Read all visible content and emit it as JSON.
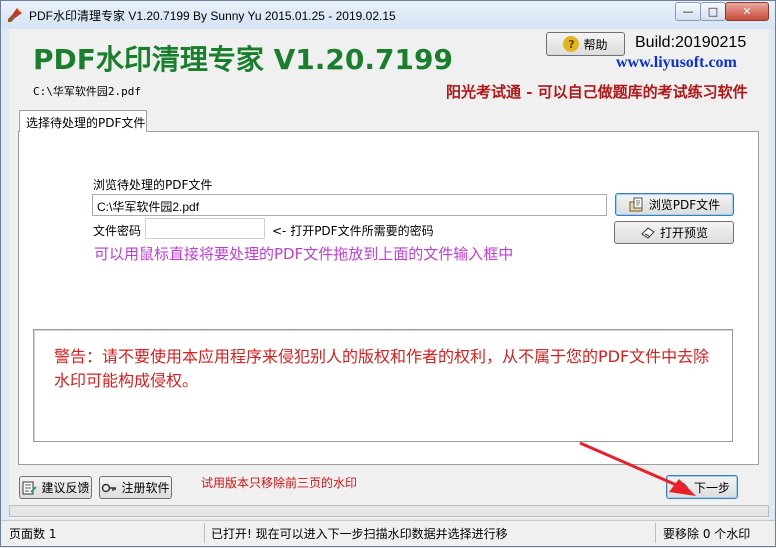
{
  "window": {
    "title": "PDF水印清理专家 V1.20.7199 By Sunny Yu 2015.01.25 - 2019.02.15",
    "minimize_symbol": "—",
    "maximize_symbol": "□",
    "close_symbol": "✕"
  },
  "header": {
    "app_title": "PDF水印清理专家 V1.20.7199",
    "help_label": "帮助",
    "help_icon_glyph": "?",
    "build": "Build:20190215",
    "website": "www.liyusoft.com",
    "current_file": "C:\\华军软件园2.pdf",
    "slogan": "阳光考试通 - 可以自己做题库的考试练习软件"
  },
  "tabs": [
    {
      "label": "选择待处理的PDF文件",
      "active": true
    }
  ],
  "main": {
    "browse_label": "浏览待处理的PDF文件",
    "file_input_value": "C:\\华军软件园2.pdf",
    "password_label": "文件密码",
    "password_value": "",
    "password_hint": "<- 打开PDF文件所需要的密码",
    "drag_hint": "可以用鼠标直接将要处理的PDF文件拖放到上面的文件输入框中",
    "browse_button": "浏览PDF文件",
    "preview_button": "打开预览",
    "warning": "警告：请不要使用本应用程序来侵犯别人的版权和作者的权利，从不属于您的PDF文件中去除水印可能构成侵权。"
  },
  "footer": {
    "feedback_button": "建议反馈",
    "register_button": "注册软件",
    "trial_note": "试用版本只移除前三页的水印",
    "next_button": "下一步"
  },
  "statusbar": {
    "page_count": "页面数 1",
    "message": "已打开! 现在可以进入下一步扫描水印数据并选择进行移",
    "watermark_count": "要移除 0 个水印"
  },
  "colors": {
    "title_green": "#1a7f2c",
    "website_blue": "#0b2fd8",
    "slogan_red": "#b01818",
    "hint_magenta": "#c23bd6",
    "warning_red": "#d81e1e",
    "annotation_arrow": "#e8202a"
  }
}
